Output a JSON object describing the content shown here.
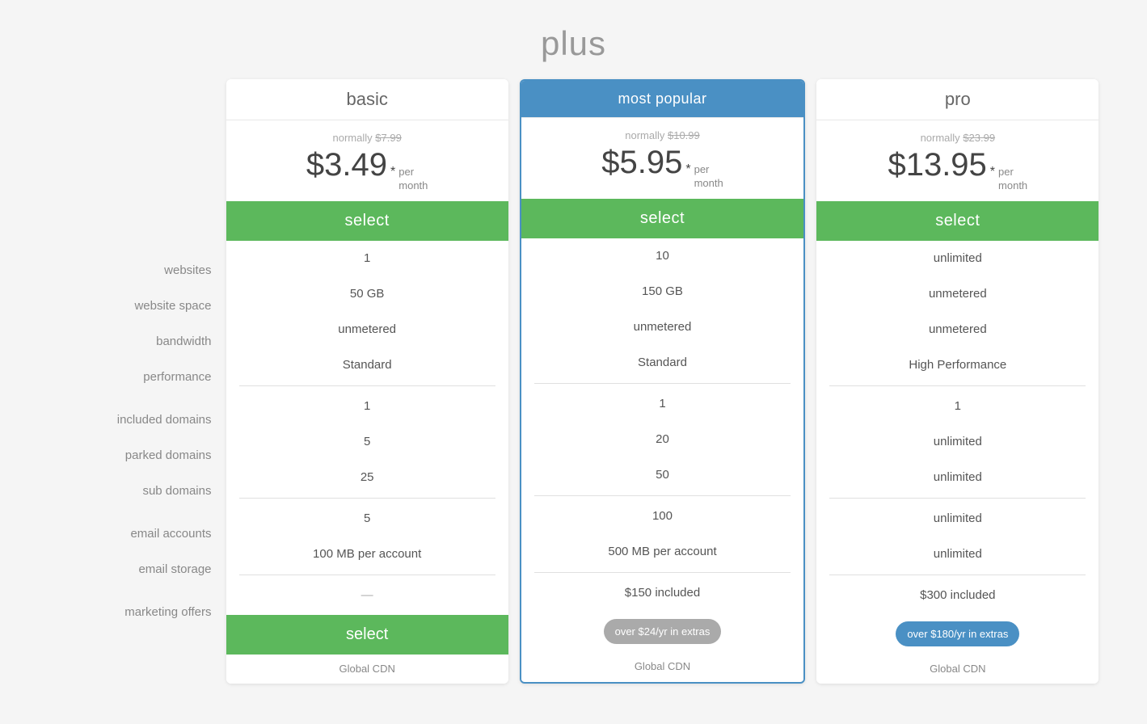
{
  "page": {
    "title": "plus"
  },
  "plans": [
    {
      "id": "basic",
      "name": "basic",
      "featured": false,
      "normally_label": "normally",
      "original_price": "$7.99",
      "price": "$3.49",
      "asterisk": "*",
      "per": "per",
      "month": "month",
      "select_label": "select",
      "websites": "1",
      "website_space": "50 GB",
      "bandwidth": "unmetered",
      "performance": "Standard",
      "included_domains": "1",
      "parked_domains": "5",
      "sub_domains": "25",
      "email_accounts": "5",
      "email_storage": "100 MB per account",
      "marketing_offers": "—",
      "extras_badge": null,
      "global_cdn": "Global CDN",
      "bottom_select_label": "select"
    },
    {
      "id": "plus",
      "name": "most popular",
      "featured": true,
      "normally_label": "normally",
      "original_price": "$10.99",
      "price": "$5.95",
      "asterisk": "*",
      "per": "per",
      "month": "month",
      "select_label": "select",
      "websites": "10",
      "website_space": "150 GB",
      "bandwidth": "unmetered",
      "performance": "Standard",
      "included_domains": "1",
      "parked_domains": "20",
      "sub_domains": "50",
      "email_accounts": "100",
      "email_storage": "500 MB per account",
      "marketing_offers": "$150 included",
      "extras_badge": "over $24/yr in extras",
      "extras_badge_type": "gray",
      "global_cdn": "Global CDN",
      "bottom_select_label": null
    },
    {
      "id": "pro",
      "name": "pro",
      "featured": false,
      "normally_label": "normally",
      "original_price": "$23.99",
      "price": "$13.95",
      "asterisk": "*",
      "per": "per",
      "month": "month",
      "select_label": "select",
      "websites": "unlimited",
      "website_space": "unmetered",
      "bandwidth": "unmetered",
      "performance": "High Performance",
      "included_domains": "1",
      "parked_domains": "unlimited",
      "sub_domains": "unlimited",
      "email_accounts": "unlimited",
      "email_storage": "unlimited",
      "marketing_offers": "$300 included",
      "extras_badge": "over $180/yr in extras",
      "extras_badge_type": "blue",
      "global_cdn": "Global CDN",
      "bottom_select_label": null
    }
  ],
  "row_labels": {
    "websites": "websites",
    "website_space": "website space",
    "bandwidth": "bandwidth",
    "performance": "performance",
    "included_domains": "included domains",
    "parked_domains": "parked domains",
    "sub_domains": "sub domains",
    "email_accounts": "email accounts",
    "email_storage": "email storage",
    "marketing_offers": "marketing offers"
  }
}
